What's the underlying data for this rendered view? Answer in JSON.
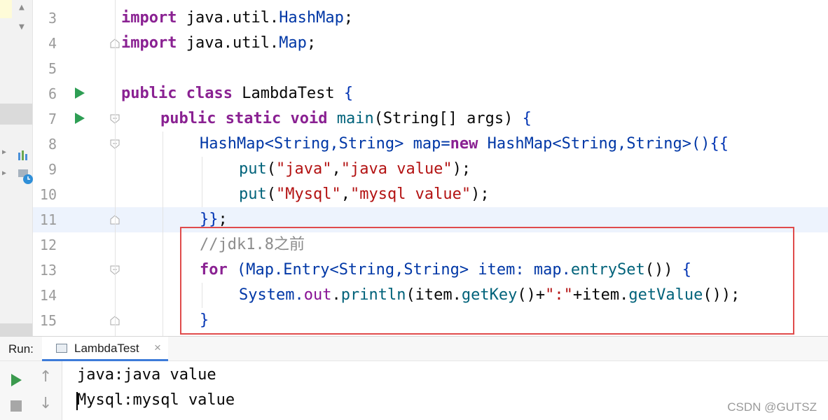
{
  "editor": {
    "lines": [
      {
        "num": "3"
      },
      {
        "num": "4"
      },
      {
        "num": "5"
      },
      {
        "num": "6"
      },
      {
        "num": "7"
      },
      {
        "num": "8"
      },
      {
        "num": "9"
      },
      {
        "num": "10"
      },
      {
        "num": "11"
      },
      {
        "num": "12"
      },
      {
        "num": "13"
      },
      {
        "num": "14"
      },
      {
        "num": "15"
      }
    ],
    "code": {
      "l3": {
        "k": "import",
        "t1": " java.util.",
        "c": "HashMap",
        "t2": ";"
      },
      "l4": {
        "k": "import",
        "t1": " java.util.",
        "c": "Map",
        "t2": ";"
      },
      "l6": {
        "k1": "public",
        "k2": "class",
        "c": "LambdaTest",
        "b": "{"
      },
      "l7": {
        "k1": "public",
        "k2": "static",
        "k3": "void",
        "f": "main",
        "t": "(String[] args)",
        "b": "{"
      },
      "l8": {
        "t1": "HashMap<String,String> map=",
        "k": "new",
        "t2": " HashMap<String,String>()",
        "b": "{{"
      },
      "l9": {
        "f": "put",
        "t1": "(",
        "s1": "\"java\"",
        "t2": ",",
        "s2": "\"java value\"",
        "t3": ");"
      },
      "l10": {
        "f": "put",
        "t1": "(",
        "s1": "\"Mysql\"",
        "t2": ",",
        "s2": "\"mysql value\"",
        "t3": ");"
      },
      "l11": {
        "b": "}}",
        "t": ";"
      },
      "l12": {
        "cmt": "//jdk1.8之前"
      },
      "l13": {
        "k": "for",
        "t1": " (Map.Entry<String,String> item: map.",
        "f": "entrySet",
        "t2": "()) ",
        "b": "{"
      },
      "l14": {
        "c": "System.",
        "fld": "out",
        "t1": ".",
        "f1": "println",
        "t2": "(item.",
        "f2": "getKey",
        "t3": "()+",
        "s": "\":\"",
        "t4": "+item.",
        "f3": "getValue",
        "t5": "());"
      },
      "l15": {
        "b": "}"
      }
    }
  },
  "run_panel": {
    "label": "Run:",
    "tab_label": "LambdaTest",
    "tab_close": "×",
    "output": [
      "java:java value",
      "Mysql:mysql value"
    ]
  },
  "watermark": "CSDN @GUTSZ",
  "colors": {
    "keyword": "#8a2192",
    "string": "#067d17",
    "annotation_box": "#e04b4b",
    "run_green": "#2e9e54",
    "tab_accent": "#3d7bd9"
  }
}
